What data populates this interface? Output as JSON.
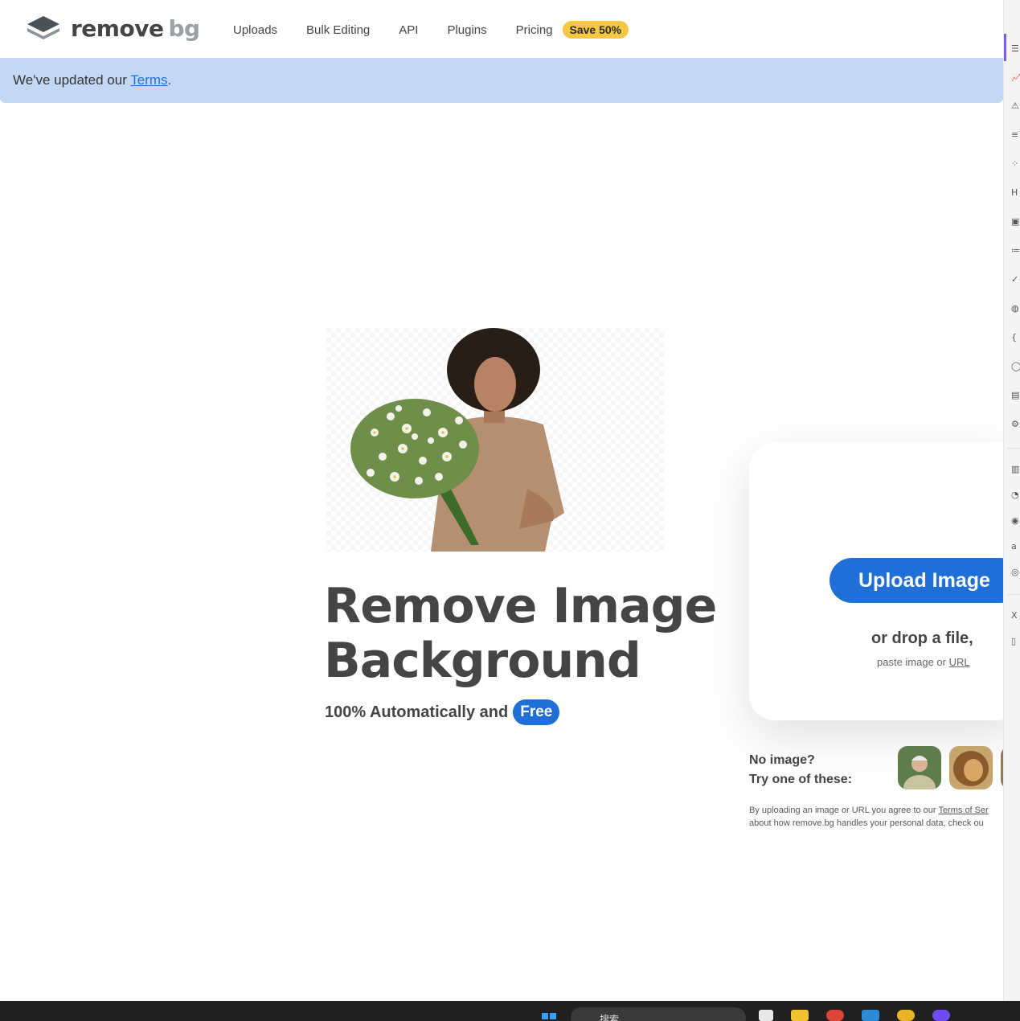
{
  "header": {
    "logo_word1": "remove",
    "logo_word2": "bg",
    "nav": {
      "uploads": "Uploads",
      "bulk_editing": "Bulk Editing",
      "api": "API",
      "plugins": "Plugins",
      "pricing": "Pricing",
      "save_badge": "Save 50%"
    }
  },
  "banner": {
    "prefix": "We've updated our ",
    "link": "Terms",
    "suffix": "."
  },
  "hero": {
    "title_line1": "Remove Image",
    "title_line2": "Background",
    "subtitle": "100% Automatically and",
    "free_badge": "Free"
  },
  "upload": {
    "button": "Upload Image",
    "drop_text": "or drop a file,",
    "paste_prefix": "paste image or ",
    "paste_link": "URL"
  },
  "samples": {
    "line1": "No image?",
    "line2": "Try one of these:"
  },
  "legal": {
    "line1_prefix": "By uploading an image or URL you agree to our ",
    "line1_link": "Terms of Ser",
    "line2": "about how remove.bg handles your personal data, check ou"
  },
  "taskbar": {
    "search_placeholder": "搜索"
  },
  "colors": {
    "brand_blue": "#1f6fd6",
    "badge_yellow": "#f7c744",
    "banner_blue": "#c3d8f5",
    "text_dark": "#454545"
  }
}
